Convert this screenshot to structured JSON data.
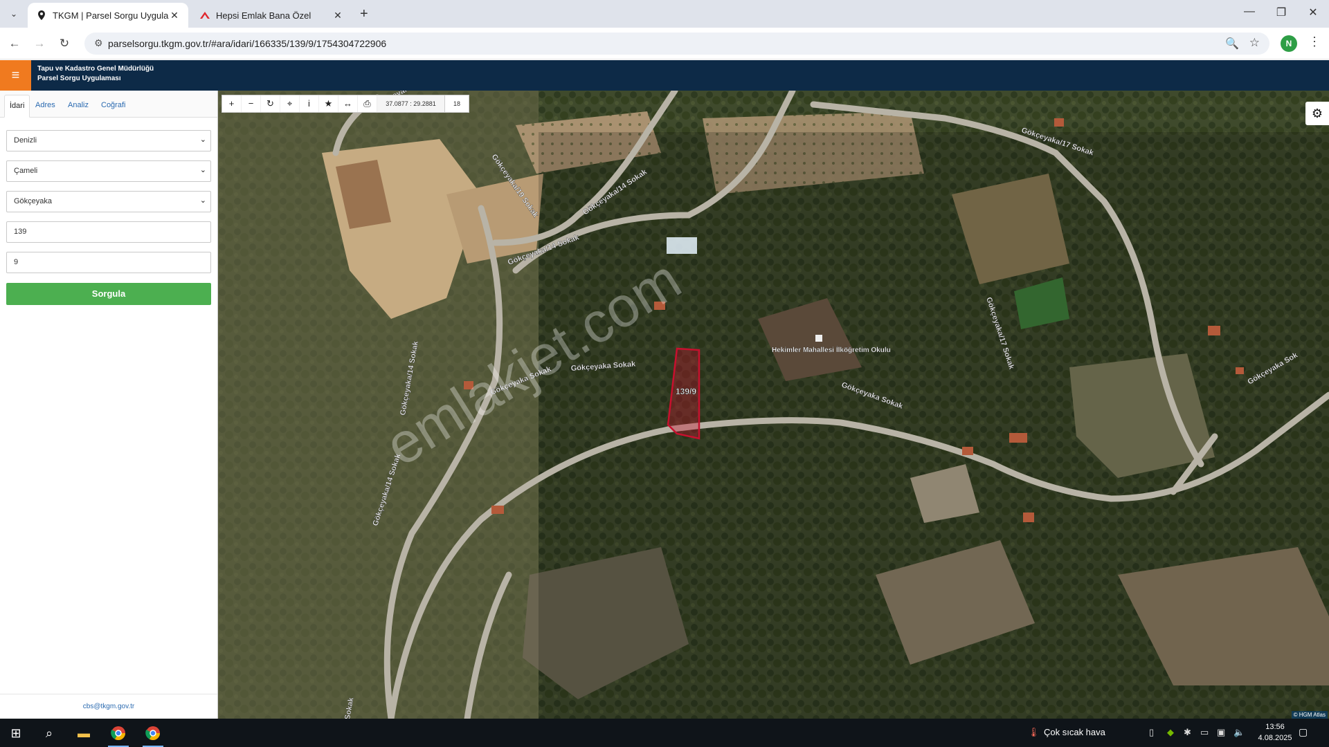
{
  "browser": {
    "tabs": [
      {
        "title": "TKGM | Parsel Sorgu Uygulama",
        "active": true
      },
      {
        "title": "Hepsi Emlak Bana Özel",
        "active": false
      }
    ],
    "url": "parselsorgu.tkgm.gov.tr/#ara/idari/166335/139/9/1754304722906",
    "profile_initial": "N"
  },
  "app": {
    "title_line1": "Tapu ve Kadastro Genel Müdürlüğü",
    "title_line2": "Parsel Sorgu Uygulaması"
  },
  "sidebar": {
    "tabs": [
      "İdari",
      "Adres",
      "Analiz",
      "Coğrafi"
    ],
    "active_tab": "İdari",
    "fields": {
      "il": "Denizli",
      "ilce": "Çameli",
      "mahalle": "Gökçeyaka",
      "ada": "139",
      "parsel": "9"
    },
    "query_button": "Sorgula",
    "footer_email": "cbs@tkgm.gov.tr"
  },
  "map": {
    "coords": "37.0877 : 29.2881",
    "zoom": "18",
    "parcel_label": "139/9",
    "watermark": "emlakjet.com",
    "attribution": "© HGM Atlas",
    "road_labels": {
      "r1": "Gökçeyaka/19 Sokak",
      "r2": "Gökçeyaka/19 Sokak",
      "r3": "Gökçeyaka/14 Sokak",
      "r4": "Gökçeyaka/14 Sokak",
      "r5": "Gökçeyaka/17 Sokak",
      "r6": "Gökçeyaka/14 Sokak",
      "r7": "Gökçeyaka Sokak",
      "r8": "Gökçeyaka Sokak",
      "r9": "Gökçeyaka Sokak",
      "r10": "Gökçeyaka/17 Sokak",
      "r11": "Gökçeyaka Sok",
      "r12": "Gökçeyaka/14 Sokak",
      "r13": "Sokak"
    },
    "poi_label": "Hekimler Mahallesi İlköğretim Okulu"
  },
  "taskbar": {
    "weather": "Çok sıcak hava",
    "time": "13:56",
    "date": "4.08.2025"
  },
  "colors": {
    "header": "#0d2a47",
    "hamburger": "#f07a1f",
    "query_button": "#4caf50",
    "parcel": "#c8102e"
  }
}
